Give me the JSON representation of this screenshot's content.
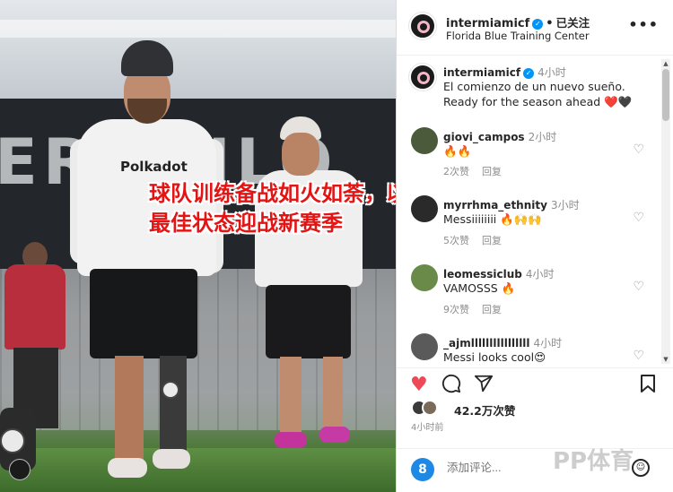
{
  "post": {
    "overlay_caption_line1": "球队训练备战如火如荼，以",
    "overlay_caption_line2": "最佳状态迎战新赛季",
    "sponsor_text": "Polkadot",
    "wall_text": "ER ANLO"
  },
  "header": {
    "username": "intermiamicf",
    "verified_mark": "✓",
    "separator": "•",
    "follow_label": "已关注",
    "location": "Florida Blue Training Center",
    "more_label": "•••"
  },
  "caption": {
    "username": "intermiamicf",
    "time": "4小时",
    "line1": "El comienzo de un nuevo sueño.",
    "line2": "Ready for the season ahead ❤️🖤"
  },
  "comments": [
    {
      "username": "giovi_campos",
      "time": "2小时",
      "text": "🔥🔥",
      "likes": "2次赞",
      "reply": "回复"
    },
    {
      "username": "myrrhma_ethnity",
      "time": "3小时",
      "text": "Messiiiiiiii 🔥🙌🙌",
      "likes": "5次赞",
      "reply": "回复"
    },
    {
      "username": "leomessiclub",
      "time": "4小时",
      "text": "VAMOSSS 🔥",
      "likes": "9次赞",
      "reply": "回复"
    },
    {
      "username": "_ajmllllllllllllllll",
      "time": "4小时",
      "text": "Messi looks cool😍",
      "likes": "",
      "reply": ""
    }
  ],
  "actions": {
    "like_icon": "heart-icon",
    "comment_icon": "comment-icon",
    "share_icon": "share-icon",
    "save_icon": "bookmark-icon",
    "like_color": "#ed4956"
  },
  "likes": {
    "count_text": "42.2万次赞"
  },
  "post_time": "4小时前",
  "add_comment": {
    "placeholder": "添加评论..."
  },
  "watermark": "PP体育"
}
